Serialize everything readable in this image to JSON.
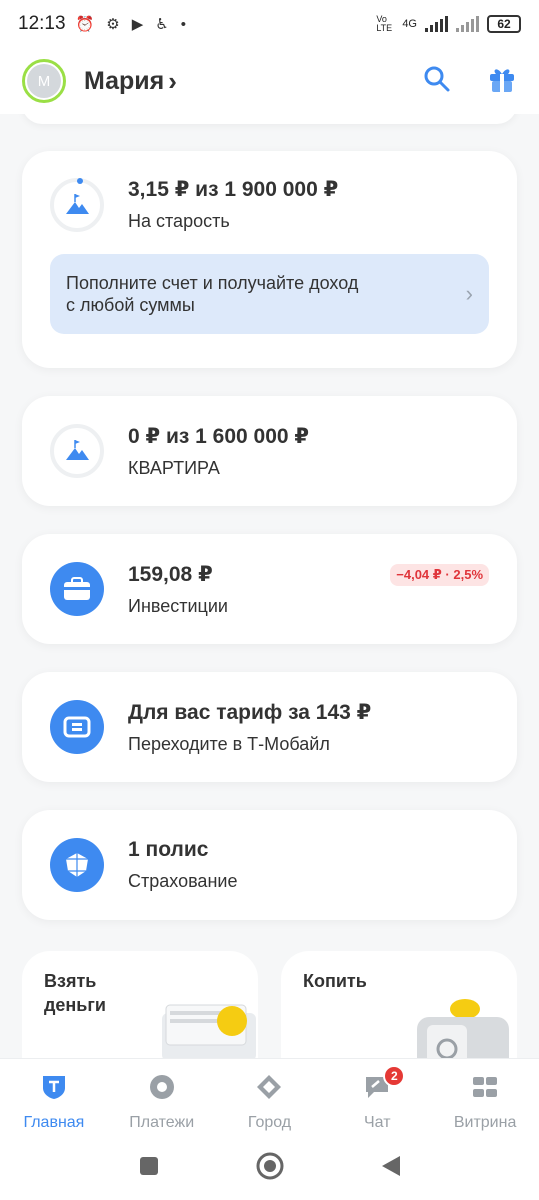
{
  "status_bar": {
    "time": "12:13",
    "network": "4G",
    "volte": "Vo LTE",
    "battery": "62"
  },
  "header": {
    "avatar_initial": "М",
    "user_name": "Мария",
    "chevron": "›"
  },
  "cards": [
    {
      "amount": "3,15 ₽ из 1 900 000 ₽",
      "label": "На старость",
      "icon": "goal-mountain-icon",
      "hint": {
        "line1": "Пополните счет и получайте доход",
        "line2": "с любой суммы"
      }
    },
    {
      "amount": "0 ₽ из 1 600 000 ₽",
      "label": "КВАРТИРА",
      "icon": "goal-mountain-icon"
    },
    {
      "amount": "159,08 ₽",
      "label": "Инвестиции",
      "icon": "briefcase-icon",
      "badge": "−4,04 ₽ · 2,5%"
    },
    {
      "amount": "Для вас тариф за 143 ₽",
      "label": "Переходите в Т-Мобайл",
      "icon": "sim-card-icon"
    },
    {
      "amount": "1 полис",
      "label": "Страхование",
      "icon": "umbrella-icon"
    }
  ],
  "tiles": [
    {
      "title_line1": "Взять",
      "title_line2": "деньги",
      "icon": "money-stack-icon"
    },
    {
      "title_line1": "Копить",
      "title_line2": "",
      "icon": "safe-coin-icon"
    }
  ],
  "bottom_nav": [
    {
      "label": "Главная",
      "icon": "home-shield-icon",
      "active": true
    },
    {
      "label": "Платежи",
      "icon": "payments-circle-icon"
    },
    {
      "label": "Город",
      "icon": "city-diamond-icon"
    },
    {
      "label": "Чат",
      "icon": "chat-icon",
      "badge": "2"
    },
    {
      "label": "Витрина",
      "icon": "showcase-grid-icon"
    }
  ],
  "colors": {
    "accent": "#3e8af0",
    "badge_red": "#e53935",
    "hint_bg": "#dde9fa"
  }
}
